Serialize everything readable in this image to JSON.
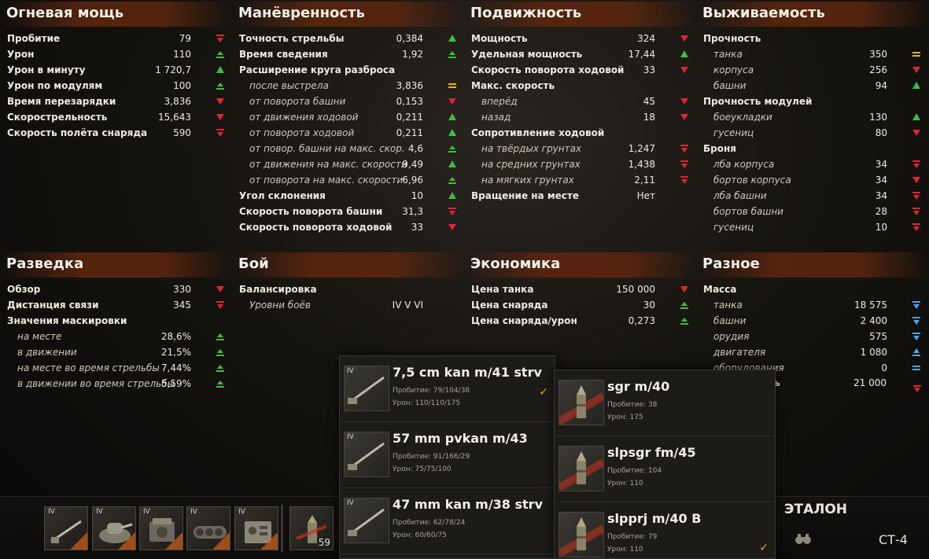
{
  "colors": {
    "up": "#3fbf3a",
    "down": "#e0262a",
    "equal": "#e8b418",
    "info": "#4da4e6"
  },
  "panels": [
    {
      "title": "Огневая мощь",
      "rows": [
        {
          "label": "Пробитие",
          "value": "79",
          "ind": "down",
          "sub": false
        },
        {
          "label": "Урон",
          "value": "110",
          "ind": "up-small",
          "sub": false
        },
        {
          "label": "Урон в минуту",
          "value": "1 720,7",
          "ind": "up",
          "sub": false
        },
        {
          "label": "Урон по модулям",
          "value": "100",
          "ind": "up-small",
          "sub": false
        },
        {
          "label": "Время перезарядки",
          "value": "3,836",
          "ind": "down-small",
          "sub": false
        },
        {
          "label": "Скорострельность",
          "value": "15,643",
          "ind": "down-small",
          "sub": false
        },
        {
          "label": "Скорость полёта снаряда",
          "value": "590",
          "ind": "down",
          "sub": false
        }
      ]
    },
    {
      "title": "Манёвренность",
      "rows": [
        {
          "label": "Точность стрельбы",
          "value": "0,384",
          "ind": "up",
          "sub": false
        },
        {
          "label": "Время сведения",
          "value": "1,92",
          "ind": "up-small",
          "sub": false
        },
        {
          "label": "Расширение круга разброса",
          "value": "",
          "ind": "",
          "sub": false
        },
        {
          "label": "после выстрела",
          "value": "3,836",
          "ind": "equal",
          "sub": true
        },
        {
          "label": "от поворота башни",
          "value": "0,153",
          "ind": "down-small",
          "sub": true
        },
        {
          "label": "от движения ходовой",
          "value": "0,211",
          "ind": "up",
          "sub": true
        },
        {
          "label": "от поворота ходовой",
          "value": "0,211",
          "ind": "up",
          "sub": true
        },
        {
          "label": "от повор. башни на макс. скор.",
          "value": "4,6",
          "ind": "up-small",
          "sub": true
        },
        {
          "label": "от движения на макс. скорости",
          "value": "9,49",
          "ind": "up",
          "sub": true
        },
        {
          "label": "от поворота на макс. скорости",
          "value": "6,96",
          "ind": "up-small",
          "sub": true
        },
        {
          "label": "Угол склонения",
          "value": "10",
          "ind": "up",
          "sub": false
        },
        {
          "label": "Скорость поворота башни",
          "value": "31,3",
          "ind": "down",
          "sub": false
        },
        {
          "label": "Скорость поворота ходовой",
          "value": "33",
          "ind": "down-small",
          "sub": false
        }
      ]
    },
    {
      "title": "Подвижность",
      "rows": [
        {
          "label": "Мощность",
          "value": "324",
          "ind": "down-small",
          "sub": false
        },
        {
          "label": "Удельная мощность",
          "value": "17,44",
          "ind": "up",
          "sub": false
        },
        {
          "label": "Скорость поворота ходовой",
          "value": "33",
          "ind": "down-small",
          "sub": false
        },
        {
          "label": "Макс. скорость",
          "value": "",
          "ind": "",
          "sub": false
        },
        {
          "label": "вперёд",
          "value": "45",
          "ind": "down-small",
          "sub": true
        },
        {
          "label": "назад",
          "value": "18",
          "ind": "down-small",
          "sub": true
        },
        {
          "label": "Сопротивление ходовой",
          "value": "",
          "ind": "",
          "sub": false
        },
        {
          "label": "на твёрдых грунтах",
          "value": "1,247",
          "ind": "down",
          "sub": true
        },
        {
          "label": "на средних грунтах",
          "value": "1,438",
          "ind": "down",
          "sub": true
        },
        {
          "label": "на мягких грунтах",
          "value": "2,11",
          "ind": "down",
          "sub": true
        },
        {
          "label": "Вращение на месте",
          "value": "Нет",
          "ind": "",
          "sub": false
        }
      ]
    },
    {
      "title": "Выживаемость",
      "rows": [
        {
          "label": "Прочность",
          "value": "",
          "ind": "",
          "sub": false
        },
        {
          "label": "танка",
          "value": "350",
          "ind": "equal",
          "sub": true
        },
        {
          "label": "корпуса",
          "value": "256",
          "ind": "down-small",
          "sub": true
        },
        {
          "label": "башни",
          "value": "94",
          "ind": "up",
          "sub": true
        },
        {
          "label": "Прочность модулей",
          "value": "",
          "ind": "",
          "sub": false
        },
        {
          "label": "боеукладки",
          "value": "130",
          "ind": "up",
          "sub": true
        },
        {
          "label": "гусениц",
          "value": "80",
          "ind": "down-small",
          "sub": true
        },
        {
          "label": "Броня",
          "value": "",
          "ind": "",
          "sub": false
        },
        {
          "label": "лба корпуса",
          "value": "34",
          "ind": "down",
          "sub": true
        },
        {
          "label": "бортов корпуса",
          "value": "34",
          "ind": "down-small",
          "sub": true
        },
        {
          "label": "лба башни",
          "value": "34",
          "ind": "down",
          "sub": true
        },
        {
          "label": "бортов башни",
          "value": "28",
          "ind": "down",
          "sub": true
        },
        {
          "label": "гусениц",
          "value": "10",
          "ind": "down",
          "sub": true
        }
      ]
    },
    {
      "title": "Разведка",
      "rows": [
        {
          "label": "Обзор",
          "value": "330",
          "ind": "down-small",
          "sub": false
        },
        {
          "label": "Дистанция связи",
          "value": "345",
          "ind": "down",
          "sub": false
        },
        {
          "label": "Значения маскировки",
          "value": "",
          "ind": "",
          "sub": false
        },
        {
          "label": "на месте",
          "value": "28,6%",
          "ind": "up-small",
          "sub": true
        },
        {
          "label": "в движении",
          "value": "21,5%",
          "ind": "up-small",
          "sub": true
        },
        {
          "label": "на месте во время стрельбы",
          "value": "7,44%",
          "ind": "up-small",
          "sub": true
        },
        {
          "label": "в движении во время стрельбы",
          "value": "5,59%",
          "ind": "up-small",
          "sub": true
        }
      ]
    },
    {
      "title": "Бой",
      "rows": [
        {
          "label": "Балансировка",
          "value": "",
          "ind": "",
          "sub": false
        },
        {
          "label": "Уровни боёв",
          "value": "IV  V  VI",
          "ind": "",
          "sub": true
        }
      ]
    },
    {
      "title": "Экономика",
      "rows": [
        {
          "label": "Цена танка",
          "value": "150 000",
          "ind": "down-small",
          "sub": false
        },
        {
          "label": "Цена снаряда",
          "value": "30",
          "ind": "up-small",
          "sub": false
        },
        {
          "label": "Цена снаряда/урон",
          "value": "0,273",
          "ind": "up-small",
          "sub": false
        }
      ]
    },
    {
      "title": "Разное",
      "rows": [
        {
          "label": "Масса",
          "value": "",
          "ind": "",
          "sub": false
        },
        {
          "label": "танка",
          "value": "18 575",
          "ind": "info-down",
          "sub": true
        },
        {
          "label": "башни",
          "value": "2 400",
          "ind": "info-down",
          "sub": true
        },
        {
          "label": "орудия",
          "value": "575",
          "ind": "info-down",
          "sub": true
        },
        {
          "label": "двигателя",
          "value": "1 080",
          "ind": "info-up",
          "sub": true
        },
        {
          "label": "оборудования",
          "value": "0",
          "ind": "info-equal",
          "sub": true
        }
      ]
    }
  ],
  "misc_mass_partial": {
    "label": "сть",
    "value": "21 000"
  },
  "gun_dropdown": [
    {
      "tier": "IV",
      "name": "7,5 cm kan m/41 strv",
      "pen": "Пробитие: 79/104/38",
      "dmg": "Урон: 110/110/175",
      "selected": true
    },
    {
      "tier": "IV",
      "name": "57 mm pvkan m/43",
      "pen": "Пробитие: 91/166/29",
      "dmg": "Урон: 75/75/100",
      "selected": false
    },
    {
      "tier": "IV",
      "name": "47 mm kan m/38 strv",
      "pen": "Пробитие: 62/78/24",
      "dmg": "Урон: 60/60/75",
      "selected": false
    }
  ],
  "ammo_dropdown": [
    {
      "name": "sgr m/40",
      "pen": "Пробитие: 38",
      "dmg": "Урон: 175",
      "selected": false
    },
    {
      "name": "slpsgr fm/45",
      "pen": "Пробитие: 104",
      "dmg": "Урон: 110",
      "selected": false
    },
    {
      "name": "slpprj m/40 B",
      "pen": "Пробитие: 79",
      "dmg": "Урон: 110",
      "selected": true
    }
  ],
  "check_mark": "✓",
  "bottom": {
    "slots": [
      {
        "tier": "IV",
        "icon": "gun-icon"
      },
      {
        "tier": "IV",
        "icon": "turret-icon"
      },
      {
        "tier": "IV",
        "icon": "engine-icon"
      },
      {
        "tier": "IV",
        "icon": "tracks-icon"
      },
      {
        "tier": "IV",
        "icon": "radio-icon"
      }
    ],
    "ammo_count": "59",
    "etalon": "ЭТАЛОН",
    "vehicle_class": "СТ-4"
  }
}
